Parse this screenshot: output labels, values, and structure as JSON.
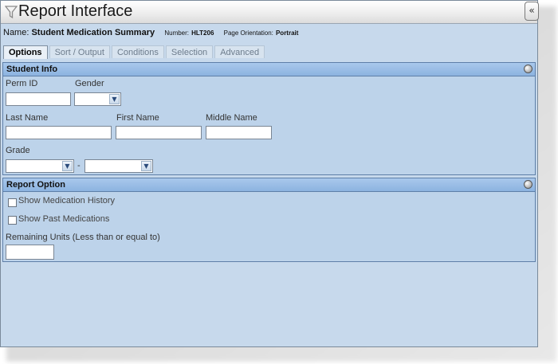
{
  "window": {
    "title": "Report Interface",
    "collapse_label": "«"
  },
  "report": {
    "name_label": "Name:",
    "name_value": "Student Medication Summary",
    "number_label": "Number:",
    "number_value": "HLT206",
    "orientation_label": "Page Orientation:",
    "orientation_value": "Portrait"
  },
  "tabs": [
    {
      "label": "Options",
      "active": true
    },
    {
      "label": "Sort / Output",
      "active": false
    },
    {
      "label": "Conditions",
      "active": false
    },
    {
      "label": "Selection",
      "active": false
    },
    {
      "label": "Advanced",
      "active": false
    }
  ],
  "student_info": {
    "header": "Student Info",
    "perm_id": {
      "label": "Perm ID",
      "value": ""
    },
    "gender": {
      "label": "Gender",
      "value": ""
    },
    "last_name": {
      "label": "Last Name",
      "value": ""
    },
    "first_name": {
      "label": "First Name",
      "value": ""
    },
    "middle_name": {
      "label": "Middle Name",
      "value": ""
    },
    "grade": {
      "label": "Grade",
      "from": "",
      "to": "",
      "separator": "-"
    }
  },
  "report_option": {
    "header": "Report Option",
    "show_medication_history": {
      "label": "Show Medication History",
      "checked": false
    },
    "show_past_medications": {
      "label": "Show Past Medications",
      "checked": false
    },
    "remaining_units": {
      "label": "Remaining Units (Less than or equal to)",
      "value": ""
    }
  },
  "colors": {
    "window_bg": "#c7d9ec",
    "panel_header": "#9bbfe7",
    "panel_border": "#5e7fa8"
  }
}
